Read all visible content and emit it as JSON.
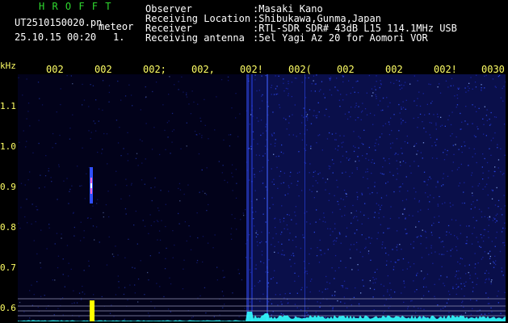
{
  "header": {
    "title": "H R O F F T",
    "filename": "UT2510150020.pn",
    "label": "meteor",
    "datetime": "25.10.15 00:20",
    "index": "1.",
    "fields": [
      {
        "label": "Observer",
        "value": ":Masaki Kano"
      },
      {
        "label": "Receiving Location",
        "value": ":Shibukawa,Gunma,Japan"
      },
      {
        "label": "Receiver",
        "value": ":RTL-SDR SDR# 43dB L15 114.1MHz USB"
      },
      {
        "label": "Receiving antenna",
        "value": ":5el Yagi Az 20 for Aomori VOR"
      }
    ]
  },
  "y_axis": {
    "unit": "kHz",
    "ticks": [
      "1.1",
      "1.0",
      "0.9",
      "0.8",
      "0.7",
      "0.6"
    ]
  },
  "x_axis": {
    "ticks": [
      "002",
      "002",
      "002;",
      "002,",
      "002!",
      "002(",
      "002",
      "002",
      "002!",
      "0030"
    ]
  },
  "colors": {
    "background": "#000000",
    "axis_text": "#ffff66",
    "title": "#2fd92f",
    "noise": "#2030c0",
    "spectrum": "#33ffff",
    "marker": "#ffff00"
  }
}
